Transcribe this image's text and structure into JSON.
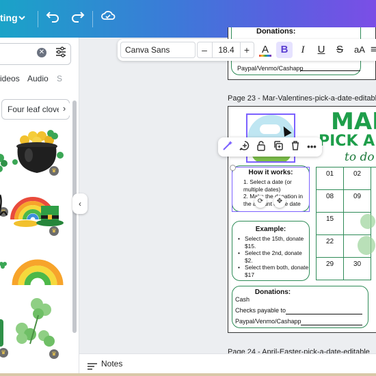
{
  "topbar": {
    "mode_label": "ting",
    "mode_chevron": "chevron-down-icon",
    "undo_icon": "undo-icon",
    "redo_icon": "redo-icon",
    "cloud_icon": "cloud-saved-icon"
  },
  "left_panel": {
    "search_placeholder": "",
    "search_clear_icon": "clear-icon",
    "filter_icon": "sliders-icon",
    "tabs": [
      "ideos",
      "Audio",
      "S"
    ],
    "chip_label": "Four leaf clove",
    "chip_next_icon": "chevron-right-icon",
    "assets": [
      {
        "name": "green-swirl-sticker",
        "premium": true
      },
      {
        "name": "pot-of-gold-sticker",
        "premium": true
      },
      {
        "name": "handwritten-sh-sticker",
        "premium": true
      },
      {
        "name": "rainbow-leprechaun-hat-sticker",
        "premium": true
      },
      {
        "name": "small-clover-sticker",
        "premium": false
      },
      {
        "name": "rainbow-arch-sticker",
        "premium": false
      },
      {
        "name": "partial-shape-sticker",
        "premium": true
      },
      {
        "name": "clover-cluster-sticker",
        "premium": true
      }
    ],
    "collapse_icon": "chevron-left-icon"
  },
  "text_toolbar": {
    "font": "Canva Sans",
    "size_minus": "–",
    "size": "18.4",
    "size_plus": "+",
    "color_button": "A",
    "bold": "B",
    "italic": "I",
    "underline": "U",
    "strikethrough": "S",
    "case": "aA",
    "more": "≡"
  },
  "canvas": {
    "prev_page": {
      "donations_title": "Donations:",
      "paypal_line": "Paypal/Venmo/Cashapp"
    },
    "page_label": "Page 23 - Mar-Valentines-pick-a-date-editable",
    "title_line1": "MAR",
    "title_line2": "PICK A D",
    "title_line3": "to do",
    "how_it_works": {
      "title": "How it works:",
      "items": [
        "1. Select a date (or multiple dates)",
        "2. Make the donation in the amount of the date"
      ]
    },
    "example": {
      "title": "Example:",
      "items": [
        "Select the 15th, donate $15.",
        "Select the 2nd, donate $2.",
        "Select them both, donate $17"
      ]
    },
    "donations": {
      "title": "Donations:",
      "cash": "Cash",
      "checks": "Checks payable to",
      "paypal": "Paypal/Venmo/Cashapp"
    },
    "calendar": [
      [
        "01",
        "02"
      ],
      [
        "08",
        "09"
      ],
      [
        "15",
        ""
      ],
      [
        "22",
        ""
      ],
      [
        "29",
        "30"
      ]
    ],
    "next_page_label": "Page 24 - April-Easter-pick-a-date-editable"
  },
  "context_toolbar": {
    "icons": [
      "magic-write-icon",
      "comment-icon",
      "lock-icon",
      "duplicate-icon",
      "trash-icon",
      "more-icon"
    ]
  },
  "bottom_bar": {
    "notes_label": "Notes"
  }
}
